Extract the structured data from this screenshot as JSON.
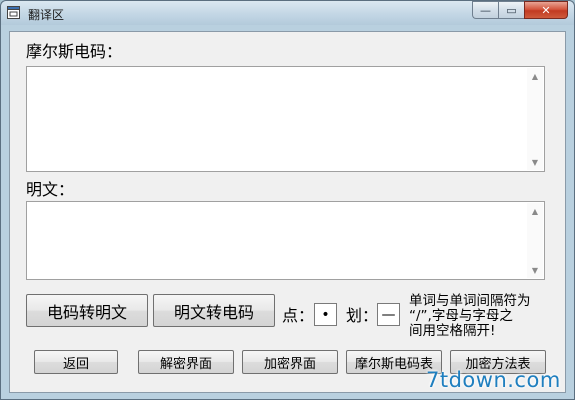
{
  "window": {
    "title": "翻译区",
    "min_glyph": "—",
    "max_glyph": "▭",
    "close_glyph": "✕"
  },
  "morse_section": {
    "label": "摩尔斯电码：",
    "value": ""
  },
  "plain_section": {
    "label": "明文：",
    "value": ""
  },
  "actions": {
    "morse_to_plain": "电码转明文",
    "plain_to_morse": "明文转电码"
  },
  "symbols": {
    "dot_label": "点：",
    "dot_value": "•",
    "dash_label": "划：",
    "dash_value": "—"
  },
  "note": {
    "line1": "单词与单词间隔符为",
    "line2": "“/”,字母与字母之",
    "line3": "间用空格隔开!"
  },
  "bottom_buttons": {
    "back": "返回",
    "decrypt": "解密界面",
    "encrypt": "加密界面",
    "morse_table": "摩尔斯电码表",
    "method_table": "加密方法表"
  },
  "watermark": "7tdown.com",
  "colors": {
    "watermark": "#1f7fbf",
    "close_button": "#c23b22"
  }
}
